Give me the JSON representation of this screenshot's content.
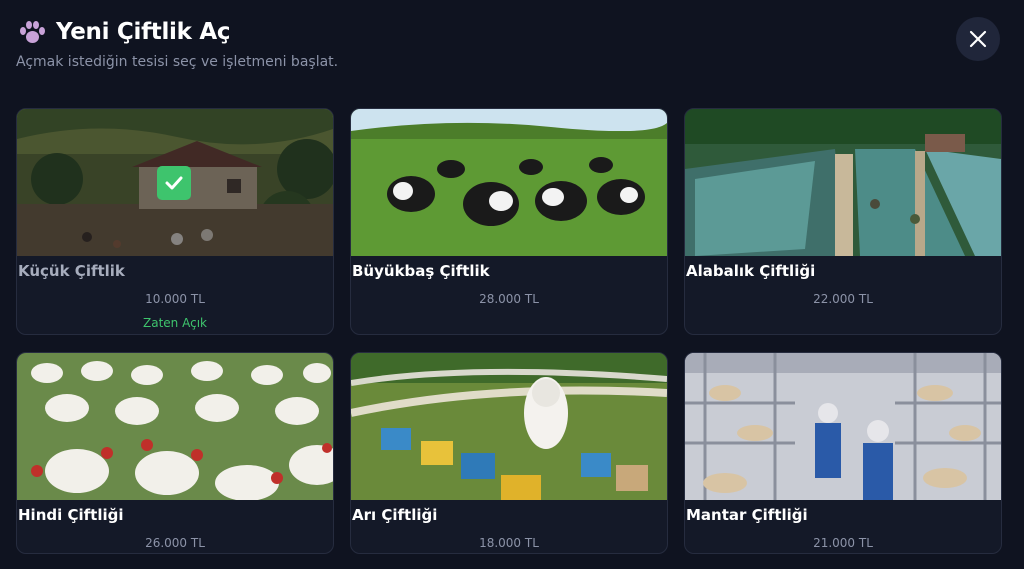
{
  "header": {
    "title": "Yeni Çiftlik Aç",
    "subtitle": "Açmak istediğin tesisi seç ve işletmeni başlat.",
    "title_icon": "paw-icon",
    "close_icon": "close-icon"
  },
  "colors": {
    "background": "#0f1320",
    "card": "#141928",
    "accent_green": "#3ec46d",
    "muted_text": "#8c93a8"
  },
  "farms": [
    {
      "name": "Küçük Çiftlik",
      "price": "10.000 TL",
      "status": "Zaten Açık",
      "owned": true
    },
    {
      "name": "Büyükbaş Çiftlik",
      "price": "28.000 TL"
    },
    {
      "name": "Alabalık Çiftliği",
      "price": "22.000 TL"
    },
    {
      "name": "Hindi Çiftliği",
      "price": "26.000 TL"
    },
    {
      "name": "Arı Çiftliği",
      "price": "18.000 TL"
    },
    {
      "name": "Mantar Çiftliği",
      "price": "21.000 TL"
    }
  ]
}
